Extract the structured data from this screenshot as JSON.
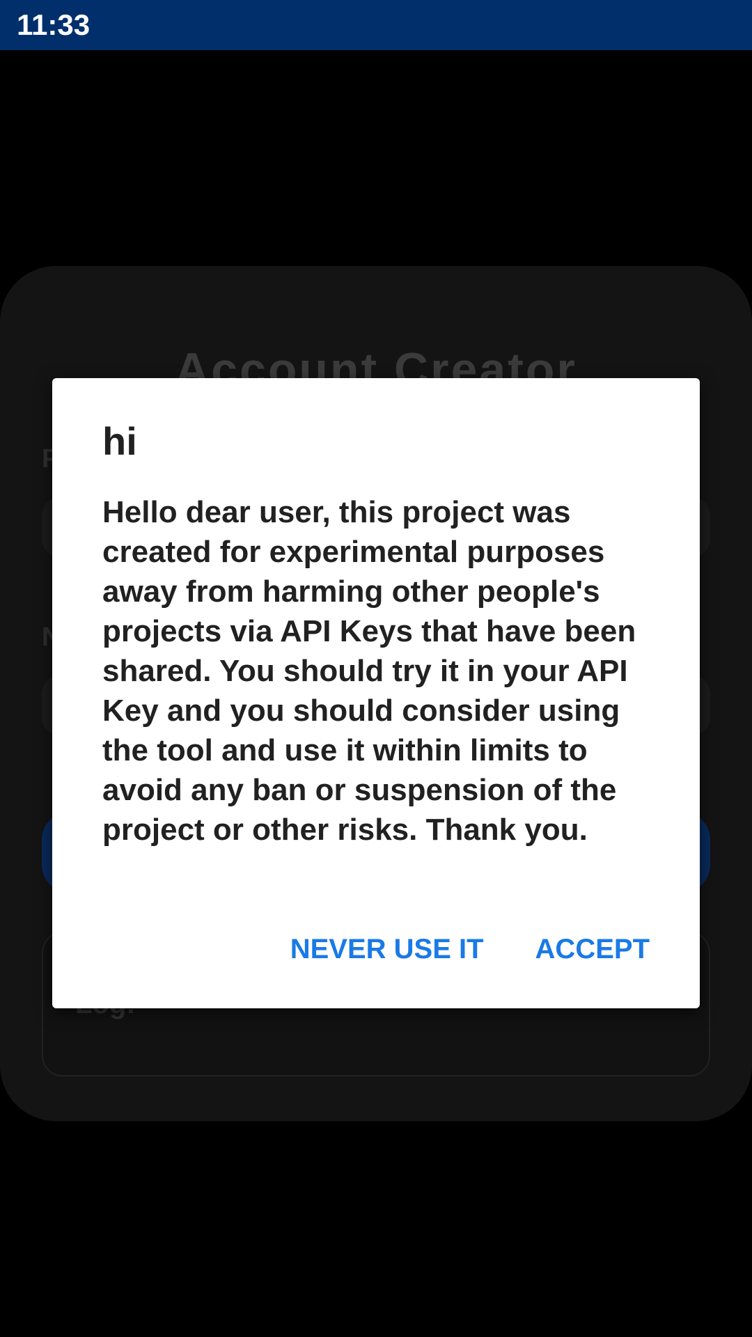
{
  "status_bar": {
    "time": "11:33"
  },
  "background_app": {
    "title": "Account Creator",
    "field1_label": "P",
    "field2_label": "N",
    "log_label": "Log:"
  },
  "dialog": {
    "title": "hi",
    "message": "Hello dear user, this project was created for experimental purposes away from harming other people's projects via API Keys that have been shared. You should try it in your API Key and you should consider using the tool and use it within limits to avoid any ban or suspension of the project or other risks. Thank you.",
    "negative_button": "NEVER USE IT",
    "positive_button": "ACCEPT"
  },
  "colors": {
    "status_bar": "#002f6c",
    "accent": "#1a7ae6",
    "dialog_background": "#ffffff",
    "scrim": "#000000"
  }
}
